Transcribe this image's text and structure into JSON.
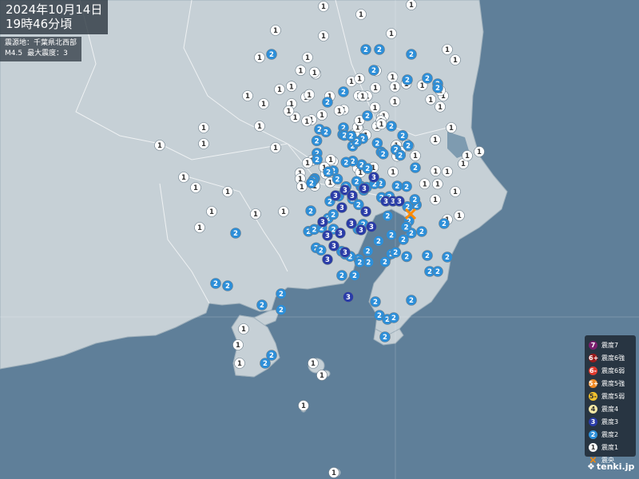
{
  "header": {
    "date": "2024年10月14日",
    "time": "19時46分頃"
  },
  "info": {
    "epicenter": "震源地：千葉県北西部",
    "magnitude": "M4.5",
    "max_intensity": "最大震度：3"
  },
  "legend": [
    {
      "label": "震度7",
      "mark": "7",
      "bg": "#7a1f6e",
      "fg": "#ffffff"
    },
    {
      "label": "震度6強",
      "mark": "6+",
      "bg": "#9b1c1c",
      "fg": "#ffffff"
    },
    {
      "label": "震度6弱",
      "mark": "6-",
      "bg": "#e03a2e",
      "fg": "#ffffff"
    },
    {
      "label": "震度5強",
      "mark": "5+",
      "bg": "#f08a24",
      "fg": "#ffffff"
    },
    {
      "label": "震度5弱",
      "mark": "5-",
      "bg": "#f2c12e",
      "fg": "#333333"
    },
    {
      "label": "震度4",
      "mark": "4",
      "bg": "#f3e7a6",
      "fg": "#333333"
    },
    {
      "label": "震度3",
      "mark": "3",
      "bg": "#2a3ca8",
      "fg": "#ffffff"
    },
    {
      "label": "震度2",
      "mark": "2",
      "bg": "#2d8fd9",
      "fg": "#ffffff"
    },
    {
      "label": "震度1",
      "mark": "1",
      "bg": "#ffffff",
      "fg": "#333333"
    },
    {
      "label": "震央",
      "mark": "×",
      "bg": "",
      "fg": "#ff8a00"
    }
  ],
  "brand": "tenki.jp",
  "colors": {
    "sea": "#5f7f99",
    "land": "#c6d0d6",
    "int1": "#ffffff",
    "int2": "#2d8fd9",
    "int3": "#2a3ca8",
    "epicenter": "#ff8a00"
  }
}
